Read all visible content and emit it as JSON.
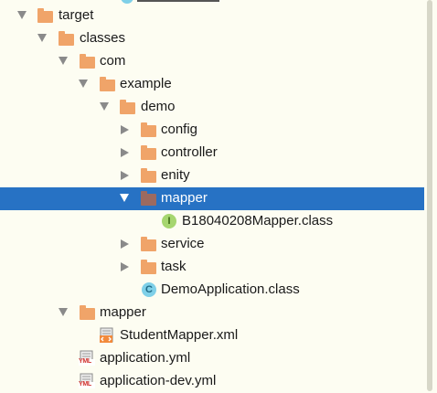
{
  "tree": {
    "items": [
      {
        "label": "target",
        "kind": "folder",
        "expanded": true
      },
      {
        "label": "classes",
        "kind": "folder",
        "expanded": true
      },
      {
        "label": "com",
        "kind": "folder",
        "expanded": true
      },
      {
        "label": "example",
        "kind": "folder",
        "expanded": true
      },
      {
        "label": "demo",
        "kind": "folder",
        "expanded": true
      },
      {
        "label": "config",
        "kind": "folder",
        "expanded": false
      },
      {
        "label": "controller",
        "kind": "folder",
        "expanded": false
      },
      {
        "label": "enity",
        "kind": "folder",
        "expanded": false
      },
      {
        "label": "mapper",
        "kind": "folder",
        "expanded": true,
        "selected": true
      },
      {
        "label": "B18040208Mapper.class",
        "kind": "interface-class",
        "badge": "I"
      },
      {
        "label": "service",
        "kind": "folder",
        "expanded": false
      },
      {
        "label": "task",
        "kind": "folder",
        "expanded": false
      },
      {
        "label": "DemoApplication.class",
        "kind": "class",
        "badge": "C"
      },
      {
        "label": "mapper",
        "kind": "folder",
        "expanded": true
      },
      {
        "label": "StudentMapper.xml",
        "kind": "xml-file"
      },
      {
        "label": "application.yml",
        "kind": "yml-file",
        "badge": "YML"
      },
      {
        "label": "application-dev.yml",
        "kind": "yml-file",
        "badge": "YML"
      }
    ]
  },
  "colors": {
    "background": "#fdfdf2",
    "selection": "#2772c4",
    "folder": "#f0a469",
    "folder_selected": "#9c6a60"
  }
}
